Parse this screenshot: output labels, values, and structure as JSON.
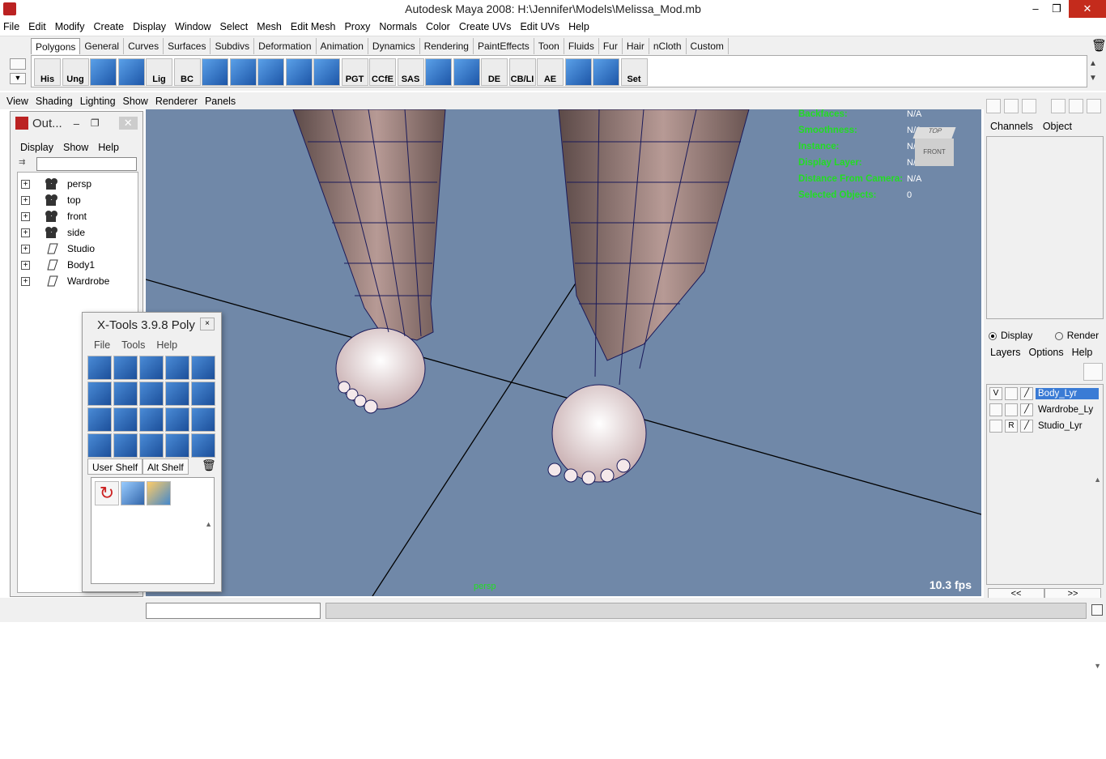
{
  "title": "Autodesk Maya 2008: H:\\Jennifer\\Models\\Melissa_Mod.mb",
  "window_controls": {
    "minimize": "–",
    "maximize": "❐",
    "close": "✕"
  },
  "menu": [
    "File",
    "Edit",
    "Modify",
    "Create",
    "Display",
    "Window",
    "Select",
    "Mesh",
    "Edit Mesh",
    "Proxy",
    "Normals",
    "Color",
    "Create UVs",
    "Edit UVs",
    "Help"
  ],
  "shelf_tabs": [
    "Polygons",
    "General",
    "Curves",
    "Surfaces",
    "Subdivs",
    "Deformation",
    "Animation",
    "Dynamics",
    "Rendering",
    "PaintEffects",
    "Toon",
    "Fluids",
    "Fur",
    "Hair",
    "nCloth",
    "Custom"
  ],
  "shelf_buttons": [
    "His",
    "Ung",
    "",
    "",
    "Lig",
    "BC",
    "",
    "",
    "",
    "",
    "",
    "PGT",
    "CCfE",
    "SAS",
    "",
    "",
    "DE",
    "CB/LI",
    "AE",
    "",
    "",
    "Set"
  ],
  "panel_menu": [
    "View",
    "Shading",
    "Lighting",
    "Show",
    "Renderer",
    "Panels"
  ],
  "hud": [
    {
      "label": "Backfaces:",
      "value": "N/A"
    },
    {
      "label": "Smoothness:",
      "value": "N/A"
    },
    {
      "label": "Instance:",
      "value": "N/A"
    },
    {
      "label": "Display Layer:",
      "value": "N/A"
    },
    {
      "label": "Distance From Camera:",
      "value": "N/A"
    },
    {
      "label": "Selected Objects:",
      "value": "0"
    }
  ],
  "viewcube": {
    "top": "TOP",
    "front": "FRONT"
  },
  "fps": "10.3 fps",
  "camera": "persp",
  "outliner": {
    "title": "Out...",
    "menu": [
      "Display",
      "Show",
      "Help"
    ],
    "items": [
      {
        "name": "persp",
        "icon": "camera-icon"
      },
      {
        "name": "top",
        "icon": "camera-icon"
      },
      {
        "name": "front",
        "icon": "camera-icon"
      },
      {
        "name": "side",
        "icon": "camera-icon"
      },
      {
        "name": "Studio",
        "icon": "transform-icon"
      },
      {
        "name": "Body1",
        "icon": "transform-icon"
      },
      {
        "name": "Wardrobe",
        "icon": "transform-icon"
      }
    ]
  },
  "xtools": {
    "title": "X-Tools 3.9.8 Poly",
    "close": "×",
    "menu": [
      "File",
      "Tools",
      "Help"
    ],
    "tabs": [
      "User Shelf",
      "Alt Shelf"
    ]
  },
  "channels": {
    "menu": [
      "Channels",
      "Object"
    ]
  },
  "layer_mode": {
    "display": "Display",
    "render": "Render"
  },
  "layers_menu": [
    "Layers",
    "Options",
    "Help"
  ],
  "layers": [
    {
      "v": "V",
      "p": "",
      "name": "Body_Lyr",
      "selected": true
    },
    {
      "v": "",
      "p": "",
      "name": "Wardrobe_Ly",
      "selected": false
    },
    {
      "v": "",
      "p": "R",
      "name": "Studio_Lyr",
      "selected": false
    }
  ],
  "layer_nav": [
    "<<",
    ">>"
  ]
}
